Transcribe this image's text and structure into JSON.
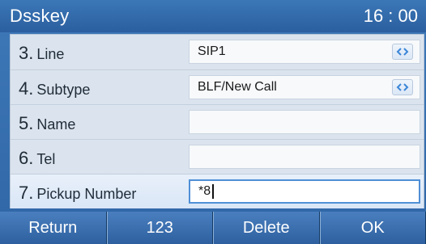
{
  "header": {
    "title": "Dsskey",
    "time": "16 : 00"
  },
  "rows": [
    {
      "number": "3.",
      "label": "Line",
      "value": "SIP1",
      "type": "select"
    },
    {
      "number": "4.",
      "label": "Subtype",
      "value": "BLF/New Call",
      "type": "select"
    },
    {
      "number": "5.",
      "label": "Name",
      "value": "",
      "type": "text"
    },
    {
      "number": "6.",
      "label": "Tel",
      "value": "",
      "type": "text"
    },
    {
      "number": "7.",
      "label": "Pickup Number",
      "value": "*8",
      "type": "text"
    }
  ],
  "softkeys": [
    "Return",
    "123",
    "Delete",
    "OK"
  ],
  "icons": {
    "selector": "left-right-arrows-icon"
  },
  "colors": {
    "accent": "#2f66a6",
    "selector_arrow": "#3b86d8"
  }
}
